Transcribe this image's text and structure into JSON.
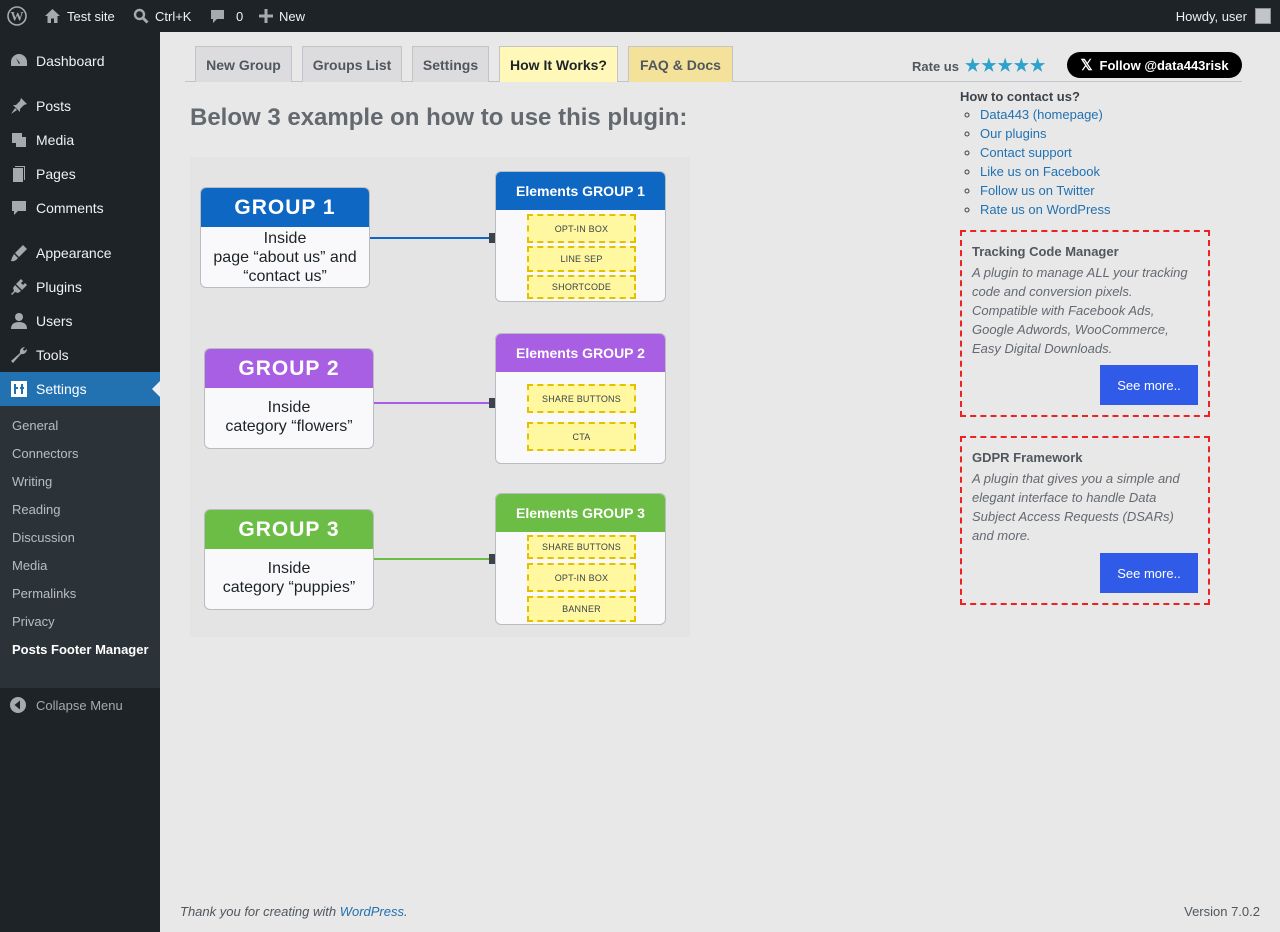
{
  "admin_bar": {
    "site_name": "Test site",
    "search_shortcut": "Ctrl+K",
    "comments_count": "0",
    "new_label": "New",
    "greeting": "Howdy, user"
  },
  "sidebar": {
    "menu": [
      {
        "label": "Dashboard",
        "icon": "dashboard-icon"
      },
      {
        "label": "Posts",
        "icon": "pushpin-icon"
      },
      {
        "label": "Media",
        "icon": "media-icon"
      },
      {
        "label": "Pages",
        "icon": "pages-icon"
      },
      {
        "label": "Comments",
        "icon": "comment-icon"
      },
      {
        "label": "Appearance",
        "icon": "brush-icon"
      },
      {
        "label": "Plugins",
        "icon": "plug-icon"
      },
      {
        "label": "Users",
        "icon": "user-icon"
      },
      {
        "label": "Tools",
        "icon": "wrench-icon"
      },
      {
        "label": "Settings",
        "icon": "settings-icon"
      }
    ],
    "submenu": [
      "General",
      "Connectors",
      "Writing",
      "Reading",
      "Discussion",
      "Media",
      "Permalinks",
      "Privacy",
      "Posts Footer Manager"
    ],
    "collapse_label": "Collapse Menu"
  },
  "tabs": [
    "New Group",
    "Groups List",
    "Settings",
    "How It Works?",
    "FAQ & Docs"
  ],
  "rate": {
    "label": "Rate us",
    "stars": 5
  },
  "follow_label": "Follow @data443risk",
  "heading": "Below 3 example on how to use this plugin:",
  "diagram": {
    "groups": [
      {
        "title": "GROUP 1",
        "body": "Inside\npage “about us” and\n“contact us”",
        "color": "#0f67c4",
        "elements_title": "Elements GROUP 1",
        "elements": [
          "OPT-IN BOX",
          "LINE SEP",
          "SHORTCODE"
        ]
      },
      {
        "title": "GROUP 2",
        "body": "Inside\ncategory “flowers”",
        "color": "#a95fe3",
        "elements_title": "Elements GROUP 2",
        "elements": [
          "SHARE BUTTONS",
          "CTA"
        ]
      },
      {
        "title": "GROUP 3",
        "body": "Inside\ncategory “puppies”",
        "color": "#6cbd45",
        "elements_title": "Elements GROUP 3",
        "elements": [
          "SHARE BUTTONS",
          "OPT-IN BOX",
          "BANNER"
        ]
      }
    ]
  },
  "contact": {
    "title": "How to contact us?",
    "links": [
      "Data443 (homepage)",
      "Our plugins",
      "Contact support",
      "Like us on Facebook",
      "Follow us on Twitter",
      "Rate us on WordPress"
    ]
  },
  "promos": [
    {
      "title": "Tracking Code Manager",
      "description": "A plugin to manage ALL your tracking code and conversion pixels. Compatible with Facebook Ads, Google Adwords, WooCommerce, Easy Digital Downloads.",
      "button": "See more.."
    },
    {
      "title": "GDPR Framework",
      "description": "A plugin that gives you a simple and elegant interface to handle Data Subject Access Requests (DSARs) and more.",
      "button": "See more.."
    }
  ],
  "footer": {
    "thanks_prefix": "Thank you for creating with ",
    "thanks_link": "WordPress",
    "thanks_suffix": ".",
    "version": "Version 7.0.2"
  },
  "colors": {
    "accent": "#2271b1",
    "admin_bg": "#1d2327",
    "promo_border": "#e22222",
    "button_blue": "#2f5be8"
  }
}
